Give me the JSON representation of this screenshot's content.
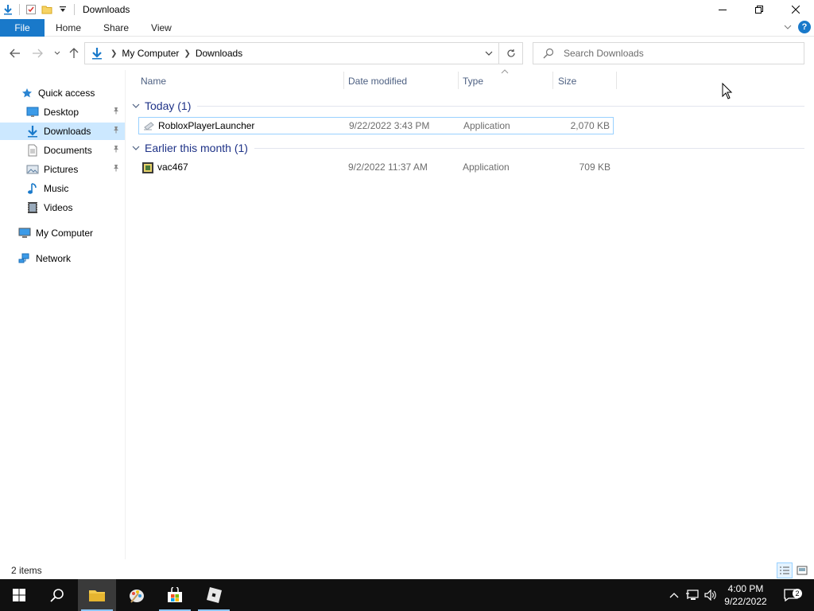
{
  "window": {
    "title": "Downloads"
  },
  "ribbon": {
    "tabs": [
      {
        "label": "File"
      },
      {
        "label": "Home"
      },
      {
        "label": "Share"
      },
      {
        "label": "View"
      }
    ]
  },
  "address": {
    "crumbs": [
      "My Computer",
      "Downloads"
    ],
    "search_placeholder": "Search Downloads"
  },
  "sidebar": {
    "items": [
      {
        "label": "Quick access",
        "icon": "star-icon"
      },
      {
        "label": "Desktop",
        "icon": "desktop-icon",
        "pinned": true
      },
      {
        "label": "Downloads",
        "icon": "download-icon",
        "pinned": true,
        "selected": true
      },
      {
        "label": "Documents",
        "icon": "documents-icon",
        "pinned": true
      },
      {
        "label": "Pictures",
        "icon": "pictures-icon",
        "pinned": true
      },
      {
        "label": "Music",
        "icon": "music-icon"
      },
      {
        "label": "Videos",
        "icon": "videos-icon"
      },
      {
        "label": "My Computer",
        "icon": "computer-icon"
      },
      {
        "label": "Network",
        "icon": "network-icon"
      }
    ]
  },
  "columns": {
    "name": "Name",
    "date": "Date modified",
    "type": "Type",
    "size": "Size"
  },
  "groups": [
    {
      "title": "Today (1)",
      "files": [
        {
          "name": "RobloxPlayerLauncher",
          "date": "9/22/2022 3:43 PM",
          "type": "Application",
          "size": "2,070 KB",
          "selected": true
        }
      ]
    },
    {
      "title": "Earlier this month (1)",
      "files": [
        {
          "name": "vac467",
          "date": "9/2/2022 11:37 AM",
          "type": "Application",
          "size": "709 KB"
        }
      ]
    }
  ],
  "status": {
    "item_count": "2 items"
  },
  "taskbar": {
    "clock_time": "4:00 PM",
    "clock_date": "9/22/2022",
    "notification_count": "2"
  },
  "colors": {
    "accent": "#1979ca",
    "selection": "#cce8ff",
    "group_title": "#1e3287",
    "taskbar": "#101010"
  }
}
